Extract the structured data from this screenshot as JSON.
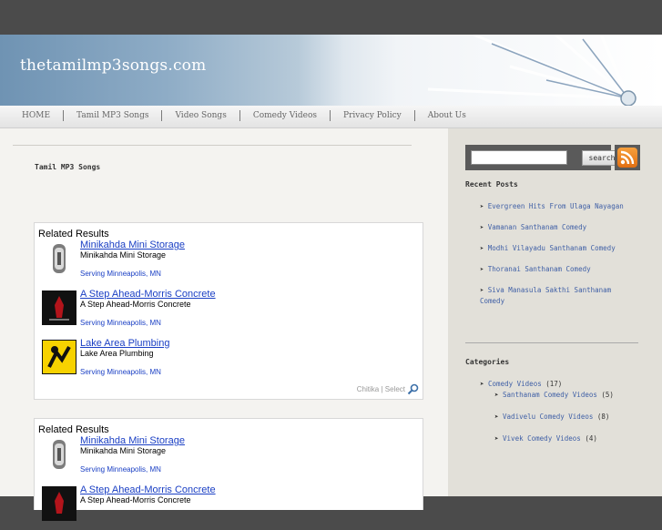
{
  "site": {
    "title": "thetamilmp3songs.com"
  },
  "nav": [
    "HOME",
    "Tamil MP3 Songs",
    "Video Songs",
    "Comedy Videos",
    "Privacy Policy",
    "About Us"
  ],
  "page": {
    "heading": "Tamil MP3 Songs"
  },
  "ads": [
    {
      "title": "Related Results",
      "items": [
        {
          "link": "Minikahda Mini Storage",
          "desc": "Minikahda Mini Storage",
          "loc": "Serving Minneapolis, MN",
          "thumb": "storage-thumbnail"
        },
        {
          "link": "A Step Ahead-Morris Concrete",
          "desc": "A Step Ahead-Morris Concrete",
          "loc": "Serving Minneapolis, MN",
          "thumb": "concrete-thumbnail"
        },
        {
          "link": "Lake Area Plumbing",
          "desc": "Lake Area Plumbing",
          "loc": "Serving Minneapolis, MN",
          "thumb": "plumbing-thumbnail"
        }
      ],
      "footer": "Chitika | Select"
    },
    {
      "title": "Related Results",
      "items": [
        {
          "link": "Minikahda Mini Storage",
          "desc": "Minikahda Mini Storage",
          "loc": "Serving Minneapolis, MN",
          "thumb": "storage-thumbnail"
        },
        {
          "link": "A Step Ahead-Morris Concrete",
          "desc": "A Step Ahead-Morris Concrete",
          "loc": "",
          "thumb": "concrete-thumbnail"
        }
      ]
    }
  ],
  "sidebar": {
    "search_button": "search",
    "search_value": "",
    "recent_title": "Recent Posts",
    "posts": [
      "Evergreen Hits From Ulaga Nayagan",
      "Vamanan Santhanam Comedy",
      "Modhi Vilayadu Santhanam Comedy",
      "Thoranai Santhanam Comedy",
      "Siva Manasula Sakthi Santhanam Comedy"
    ],
    "categories_title": "Categories",
    "categories": [
      {
        "name": "Comedy Videos",
        "count": "(17)"
      },
      {
        "name": "Santhanam Comedy Videos",
        "count": "(5)"
      },
      {
        "name": "Vadivelu Comedy Videos",
        "count": "(8)"
      },
      {
        "name": "Vivek Comedy Videos",
        "count": "(4)"
      }
    ]
  },
  "colors": {
    "link": "#1a3fc4",
    "sidebar_link": "#4060a6",
    "header_blue": "#6f93b3"
  }
}
